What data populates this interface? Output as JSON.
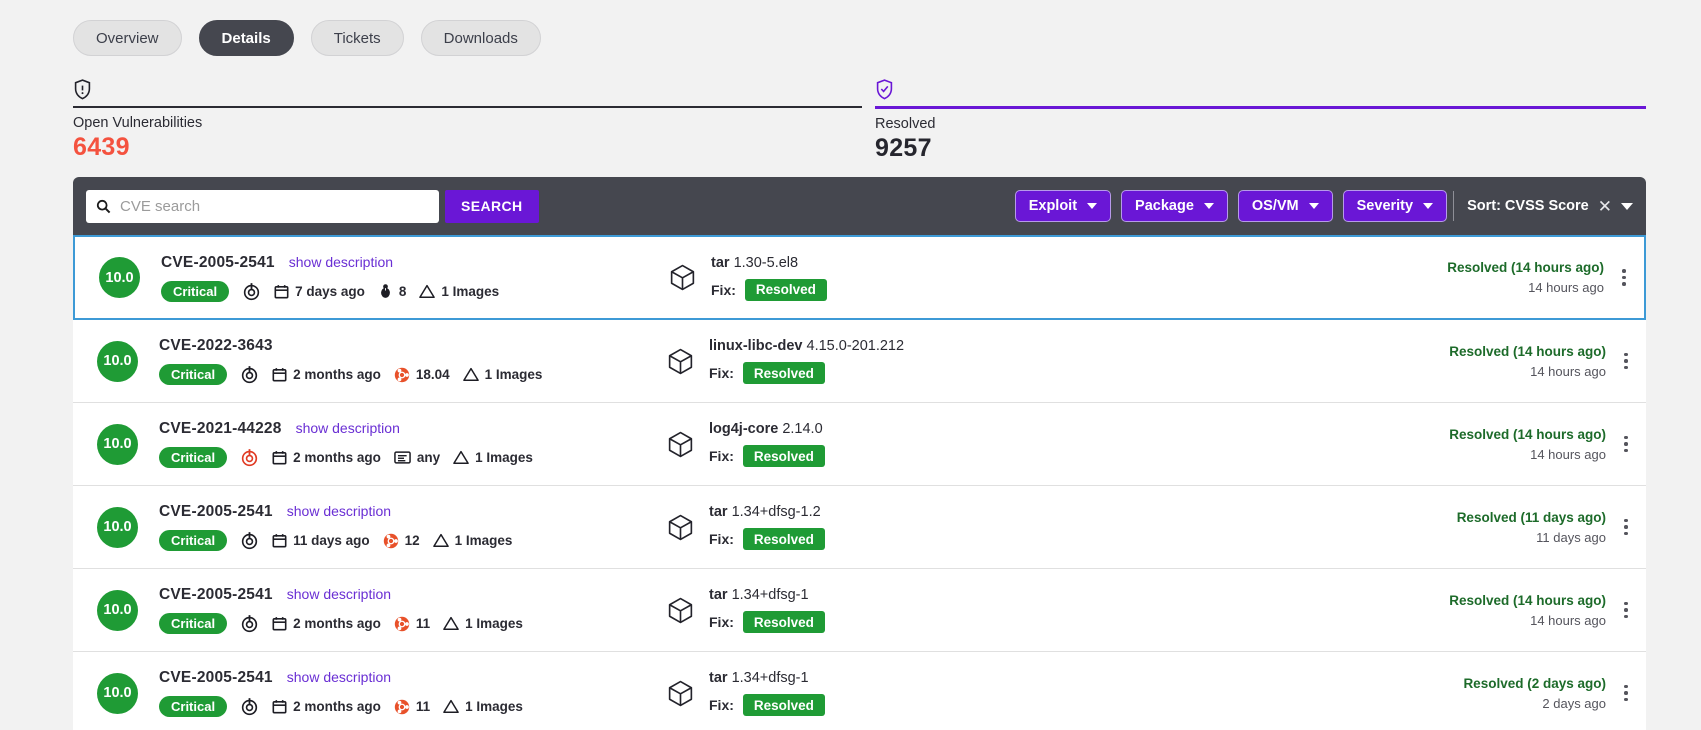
{
  "tabs": [
    {
      "label": "Overview",
      "active": false
    },
    {
      "label": "Details",
      "active": true
    },
    {
      "label": "Tickets",
      "active": false
    },
    {
      "label": "Downloads",
      "active": false
    }
  ],
  "counters": {
    "open": {
      "icon": "shield-alert-icon",
      "label": "Open Vulnerabilities",
      "value": "6439",
      "color": "#f4523f",
      "active": false
    },
    "resolved": {
      "icon": "shield-check-icon",
      "label": "Resolved",
      "value": "9257",
      "color": "#6a17d6",
      "active": true
    }
  },
  "toolbar": {
    "search": {
      "icon": "search-icon",
      "value": "",
      "placeholder": "CVE search"
    },
    "search_button": "SEARCH",
    "filters": [
      {
        "label": "Exploit"
      },
      {
        "label": "Package"
      },
      {
        "label": "OS/VM"
      },
      {
        "label": "Severity"
      }
    ],
    "sort": {
      "label": "Sort: CVSS Score",
      "clear_icon": "close-icon",
      "caret_icon": "chevron-down-icon"
    },
    "accent": "#6a17d6",
    "bar_color": "#45474f"
  },
  "rows": [
    {
      "selected": true,
      "score": "10.0",
      "cve_id": "CVE-2005-2541",
      "show_description": "show description",
      "severity": "Critical",
      "exploit_icon": "exploit-target-icon",
      "exploit_active": false,
      "date_icon": "calendar-icon",
      "date": "7 days ago",
      "source_icon": "exploit-bug-icon",
      "source": "8",
      "images_icon": "warning-triangle-icon",
      "images": "1 Images",
      "package_icon": "package-box-icon",
      "package_name": "tar",
      "package_version": "1.30-5.el8",
      "fix_label": "Fix:",
      "fix_state": "Resolved",
      "status": "Resolved (14 hours ago)",
      "status_time": "14 hours ago",
      "menu_icon": "kebab-menu-icon"
    },
    {
      "selected": false,
      "score": "10.0",
      "cve_id": "CVE-2022-3643",
      "show_description": "",
      "severity": "Critical",
      "exploit_icon": "exploit-target-icon",
      "exploit_active": false,
      "date_icon": "calendar-icon",
      "date": "2 months ago",
      "source_icon": "ubuntu-os-icon",
      "source": "18.04",
      "images_icon": "warning-triangle-icon",
      "images": "1 Images",
      "package_icon": "package-box-icon",
      "package_name": "linux-libc-dev",
      "package_version": "4.15.0-201.212",
      "fix_label": "Fix:",
      "fix_state": "Resolved",
      "status": "Resolved (14 hours ago)",
      "status_time": "14 hours ago",
      "menu_icon": "kebab-menu-icon"
    },
    {
      "selected": false,
      "score": "10.0",
      "cve_id": "CVE-2021-44228",
      "show_description": "show description",
      "severity": "Critical",
      "exploit_icon": "exploit-target-icon",
      "exploit_active": true,
      "date_icon": "calendar-icon",
      "date": "2 months ago",
      "source_icon": "list-card-icon",
      "source": "any",
      "images_icon": "warning-triangle-icon",
      "images": "1 Images",
      "package_icon": "package-box-icon",
      "package_name": "log4j-core",
      "package_version": "2.14.0",
      "fix_label": "Fix:",
      "fix_state": "Resolved",
      "status": "Resolved (14 hours ago)",
      "status_time": "14 hours ago",
      "menu_icon": "kebab-menu-icon"
    },
    {
      "selected": false,
      "score": "10.0",
      "cve_id": "CVE-2005-2541",
      "show_description": "show description",
      "severity": "Critical",
      "exploit_icon": "exploit-target-icon",
      "exploit_active": false,
      "date_icon": "calendar-icon",
      "date": "11 days ago",
      "source_icon": "ubuntu-os-icon",
      "source": "12",
      "images_icon": "warning-triangle-icon",
      "images": "1 Images",
      "package_icon": "package-box-icon",
      "package_name": "tar",
      "package_version": "1.34+dfsg-1.2",
      "fix_label": "Fix:",
      "fix_state": "Resolved",
      "status": "Resolved (11 days ago)",
      "status_time": "11 days ago",
      "menu_icon": "kebab-menu-icon"
    },
    {
      "selected": false,
      "score": "10.0",
      "cve_id": "CVE-2005-2541",
      "show_description": "show description",
      "severity": "Critical",
      "exploit_icon": "exploit-target-icon",
      "exploit_active": false,
      "date_icon": "calendar-icon",
      "date": "2 months ago",
      "source_icon": "ubuntu-os-icon",
      "source": "11",
      "images_icon": "warning-triangle-icon",
      "images": "1 Images",
      "package_icon": "package-box-icon",
      "package_name": "tar",
      "package_version": "1.34+dfsg-1",
      "fix_label": "Fix:",
      "fix_state": "Resolved",
      "status": "Resolved (14 hours ago)",
      "status_time": "14 hours ago",
      "menu_icon": "kebab-menu-icon"
    },
    {
      "selected": false,
      "score": "10.0",
      "cve_id": "CVE-2005-2541",
      "show_description": "show description",
      "severity": "Critical",
      "exploit_icon": "exploit-target-icon",
      "exploit_active": false,
      "date_icon": "calendar-icon",
      "date": "2 months ago",
      "source_icon": "ubuntu-os-icon",
      "source": "11",
      "images_icon": "warning-triangle-icon",
      "images": "1 Images",
      "package_icon": "package-box-icon",
      "package_name": "tar",
      "package_version": "1.34+dfsg-1",
      "fix_label": "Fix:",
      "fix_state": "Resolved",
      "status": "Resolved (2 days ago)",
      "status_time": "2 days ago",
      "menu_icon": "kebab-menu-icon"
    }
  ]
}
